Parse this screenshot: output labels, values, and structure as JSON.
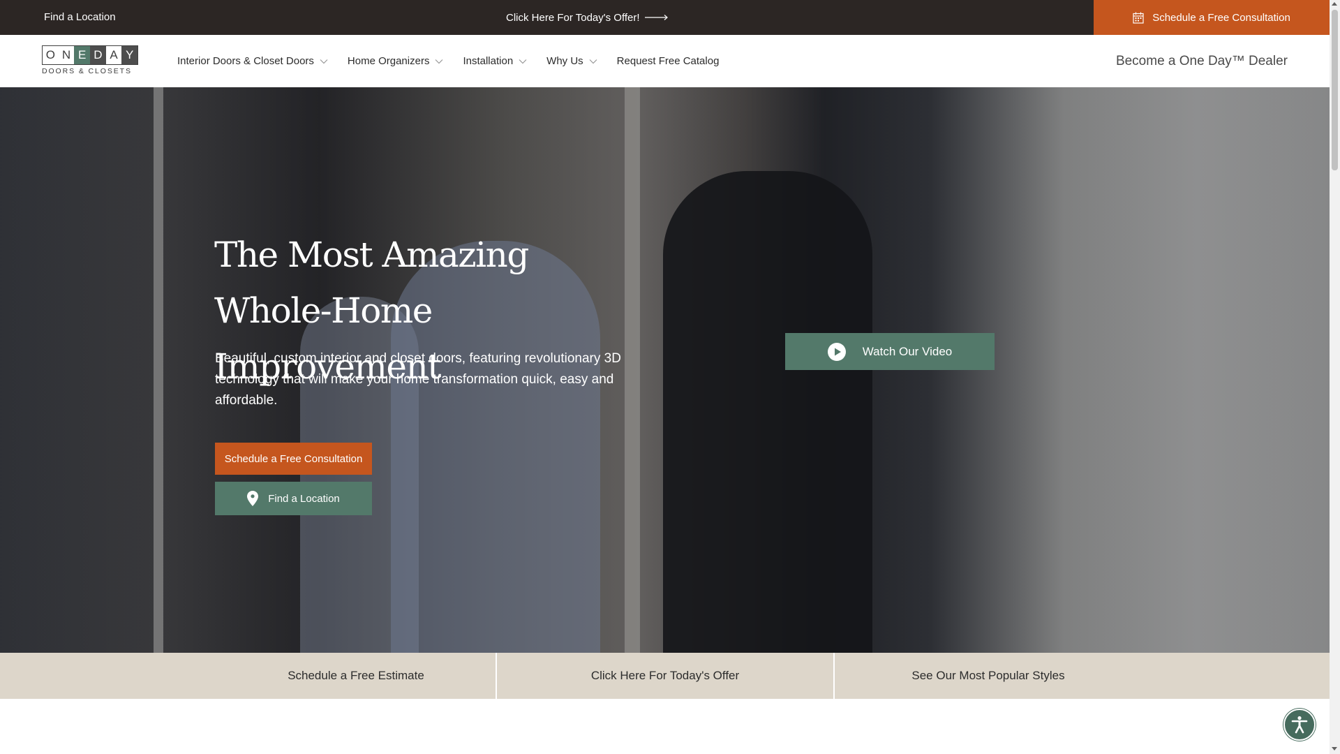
{
  "topbar": {
    "find_location": "Find a Location",
    "offer": "Click Here For Today's Offer!",
    "schedule": "Schedule a Free Consultation"
  },
  "logo": {
    "letters": [
      "O",
      "N",
      "E",
      "D",
      "A",
      "Y"
    ],
    "tagline": "DOORS & CLOSETS"
  },
  "nav": {
    "items": [
      {
        "label": "Interior Doors & Closet Doors",
        "dropdown": true
      },
      {
        "label": "Home Organizers",
        "dropdown": true
      },
      {
        "label": "Installation",
        "dropdown": true
      },
      {
        "label": "Why Us",
        "dropdown": true
      },
      {
        "label": "Request Free Catalog",
        "dropdown": false
      }
    ],
    "dealer": "Become a One Day™ Dealer"
  },
  "hero": {
    "title": "The Most Amazing Whole-Home Improvement",
    "description": "Beautiful, custom interior and closet doors, featuring revolutionary 3D technology that will make your home transformation quick, easy and affordable.",
    "schedule_button": "Schedule a Free Consultation",
    "location_button": "Find a Location",
    "video_button": "Watch Our Video"
  },
  "strip": {
    "items": [
      "Schedule a Free Estimate",
      "Click Here For Today's Offer",
      "See Our Most Popular Styles"
    ]
  },
  "colors": {
    "accent_orange": "#c5561e",
    "accent_sage": "#53796a",
    "topbar": "#2c2624",
    "strip": "#ddd6ca"
  }
}
